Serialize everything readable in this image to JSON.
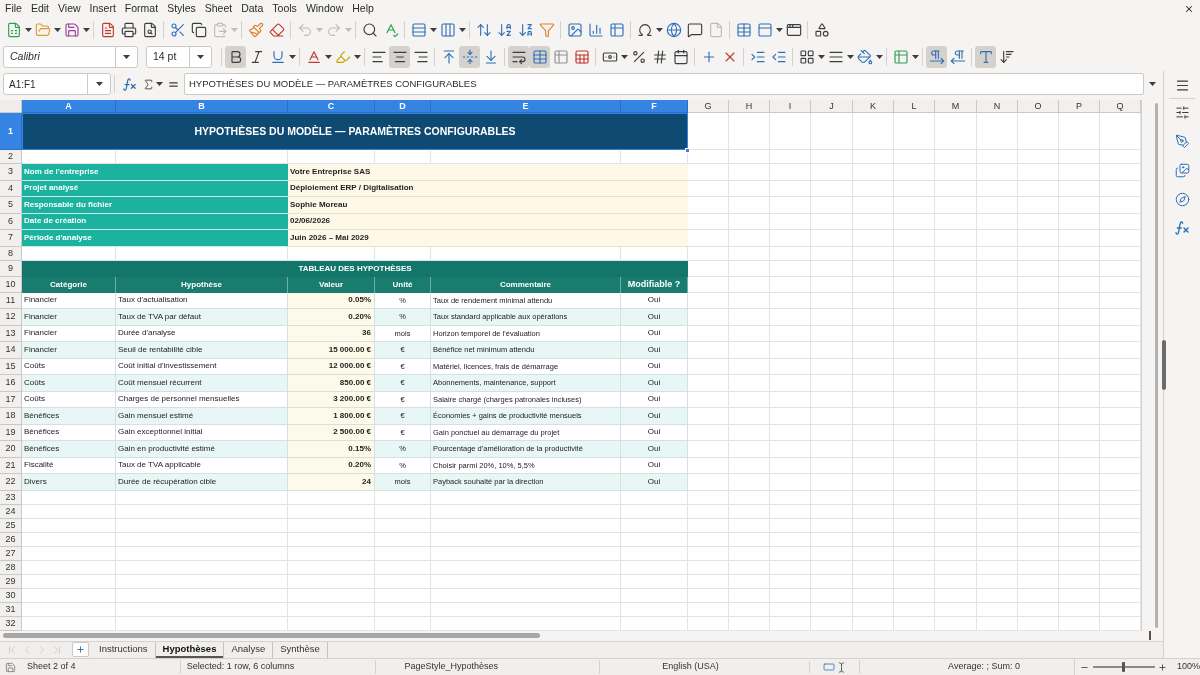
{
  "menu_bar": [
    "File",
    "Edit",
    "View",
    "Insert",
    "Format",
    "Styles",
    "Sheet",
    "Data",
    "Tools",
    "Window",
    "Help"
  ],
  "standard_toolbar": {
    "groups": [
      [
        {
          "kind": "new",
          "disabled": false
        },
        {
          "kind": "open",
          "disabled": false
        },
        {
          "kind": "save",
          "disabled": false
        }
      ],
      [
        {
          "kind": "export-pdf",
          "disabled": false
        },
        {
          "kind": "print",
          "disabled": false
        },
        {
          "kind": "print-preview",
          "disabled": false
        }
      ],
      [
        {
          "kind": "cut",
          "disabled": false
        },
        {
          "kind": "copy",
          "disabled": false
        },
        {
          "kind": "paste",
          "disabled": true
        }
      ],
      [
        {
          "kind": "clone-formatting",
          "disabled": false
        },
        {
          "kind": "clear-formatting",
          "disabled": false
        }
      ],
      [
        {
          "kind": "undo",
          "disabled": true
        },
        {
          "kind": "redo",
          "disabled": true
        }
      ],
      [
        {
          "kind": "find-replace",
          "disabled": false
        },
        {
          "kind": "spelling",
          "disabled": false
        }
      ],
      [
        {
          "kind": "rows",
          "disabled": false
        },
        {
          "kind": "columns",
          "disabled": false
        }
      ],
      [
        {
          "kind": "sort",
          "disabled": false
        },
        {
          "kind": "sort-ascending",
          "disabled": false
        },
        {
          "kind": "sort-descending",
          "disabled": false
        },
        {
          "kind": "autofilter",
          "disabled": false
        }
      ],
      [
        {
          "kind": "image",
          "disabled": false
        },
        {
          "kind": "chart",
          "disabled": false
        },
        {
          "kind": "pivot-table",
          "disabled": false
        }
      ],
      [
        {
          "kind": "special-character",
          "disabled": false
        },
        {
          "kind": "hyperlink",
          "disabled": false
        },
        {
          "kind": "comment",
          "disabled": false
        },
        {
          "kind": "header-footer",
          "disabled": true
        }
      ],
      [
        {
          "kind": "print-area",
          "disabled": false
        },
        {
          "kind": "freeze",
          "disabled": false
        },
        {
          "kind": "split-window",
          "disabled": false
        }
      ],
      [
        {
          "kind": "shapes",
          "disabled": false
        }
      ]
    ]
  },
  "formatting_toolbar": {
    "font_name": "Calibri",
    "font_size": "14 pt",
    "groups": [
      [
        {
          "kind": "bold",
          "pressed": true
        },
        {
          "kind": "italic",
          "pressed": false
        },
        {
          "kind": "underline",
          "pressed": false
        }
      ],
      [
        {
          "kind": "font-color",
          "pressed": false
        },
        {
          "kind": "highlight",
          "pressed": false
        }
      ],
      [
        {
          "kind": "align-left",
          "pressed": false
        },
        {
          "kind": "align-center",
          "pressed": true
        },
        {
          "kind": "align-right",
          "pressed": false
        }
      ],
      [
        {
          "kind": "align-top",
          "pressed": false
        },
        {
          "kind": "align-middle",
          "pressed": true
        },
        {
          "kind": "align-bottom",
          "pressed": false
        }
      ],
      [
        {
          "kind": "wrap-text",
          "pressed": true
        },
        {
          "kind": "merge-center",
          "pressed": true
        },
        {
          "kind": "merge",
          "pressed": false
        },
        {
          "kind": "unmerge",
          "pressed": false
        }
      ],
      [
        {
          "kind": "currency",
          "pressed": false
        },
        {
          "kind": "percent",
          "pressed": false
        },
        {
          "kind": "number",
          "pressed": false
        },
        {
          "kind": "date",
          "pressed": false
        }
      ],
      [
        {
          "kind": "add-decimal",
          "pressed": false
        },
        {
          "kind": "delete-decimal",
          "pressed": false
        }
      ],
      [
        {
          "kind": "indent-increase",
          "pressed": false
        },
        {
          "kind": "indent-decrease",
          "pressed": false
        }
      ],
      [
        {
          "kind": "borders",
          "pressed": false
        },
        {
          "kind": "border-style",
          "pressed": false
        },
        {
          "kind": "border-color",
          "pressed": false
        }
      ],
      [
        {
          "kind": "conditional",
          "pressed": false
        }
      ],
      [
        {
          "kind": "left-to-right",
          "pressed": true
        },
        {
          "kind": "right-to-left",
          "pressed": false
        }
      ],
      [
        {
          "kind": "text-horizontal",
          "pressed": true
        },
        {
          "kind": "text-vertical",
          "pressed": false
        }
      ]
    ]
  },
  "formula_bar": {
    "name_box": "A1:F1",
    "content": "HYPOTHÈSES DU MODÈLE — PARAMÈTRES CONFIGURABLES"
  },
  "sheet": {
    "column_headers": [
      {
        "label": "A",
        "selected": true
      },
      {
        "label": "B",
        "selected": true
      },
      {
        "label": "C",
        "selected": true
      },
      {
        "label": "D",
        "selected": true
      },
      {
        "label": "E",
        "selected": true
      },
      {
        "label": "F",
        "selected": true
      },
      {
        "label": "G",
        "selected": false
      },
      {
        "label": "H",
        "selected": false
      },
      {
        "label": "I",
        "selected": false
      },
      {
        "label": "J",
        "selected": false
      },
      {
        "label": "K",
        "selected": false
      },
      {
        "label": "L",
        "selected": false
      },
      {
        "label": "M",
        "selected": false
      },
      {
        "label": "N",
        "selected": false
      },
      {
        "label": "O",
        "selected": false
      },
      {
        "label": "P",
        "selected": false
      },
      {
        "label": "Q",
        "selected": false
      }
    ],
    "row_headers": [
      {
        "label": "1",
        "selected": true
      },
      {
        "label": "2",
        "selected": false
      },
      {
        "label": "3",
        "selected": false
      },
      {
        "label": "4",
        "selected": false
      },
      {
        "label": "5",
        "selected": false
      },
      {
        "label": "6",
        "selected": false
      },
      {
        "label": "7",
        "selected": false
      },
      {
        "label": "8",
        "selected": false
      },
      {
        "label": "9",
        "selected": false
      },
      {
        "label": "10",
        "selected": false
      },
      {
        "label": "11",
        "selected": false
      },
      {
        "label": "12",
        "selected": false
      },
      {
        "label": "13",
        "selected": false
      },
      {
        "label": "14",
        "selected": false
      },
      {
        "label": "15",
        "selected": false
      },
      {
        "label": "16",
        "selected": false
      },
      {
        "label": "17",
        "selected": false
      },
      {
        "label": "18",
        "selected": false
      },
      {
        "label": "19",
        "selected": false
      },
      {
        "label": "20",
        "selected": false
      },
      {
        "label": "21",
        "selected": false
      },
      {
        "label": "22",
        "selected": false
      },
      {
        "label": "23",
        "selected": false
      },
      {
        "label": "24",
        "selected": false
      },
      {
        "label": "25",
        "selected": false
      },
      {
        "label": "26",
        "selected": false
      },
      {
        "label": "27",
        "selected": false
      },
      {
        "label": "28",
        "selected": false
      },
      {
        "label": "29",
        "selected": false
      },
      {
        "label": "30",
        "selected": false
      },
      {
        "label": "31",
        "selected": false
      },
      {
        "label": "32",
        "selected": false
      }
    ],
    "title": "HYPOTHÈSES DU MODÈLE — PARAMÈTRES CONFIGURABLES",
    "info": [
      {
        "label": "Nom de l'entreprise",
        "value": "Votre Entreprise SAS"
      },
      {
        "label": "Projet analysé",
        "value": "Déploiement ERP / Digitalisation"
      },
      {
        "label": "Responsable du fichier",
        "value": "Sophie Moreau"
      },
      {
        "label": "Date de création",
        "value": "02/06/2026"
      },
      {
        "label": "Période d'analyse",
        "value": "Juin 2026 – Mai 2029"
      }
    ],
    "table": {
      "title": "TABLEAU DES HYPOTHÈSES",
      "columns": [
        "Catégorie",
        "Hypothèse",
        "Valeur",
        "Unité",
        "Commentaire",
        "Modifiable ?"
      ],
      "rows": [
        {
          "category": "Financier",
          "hypothesis": "Taux d'actualisation",
          "value": "0.05%",
          "unit": "%",
          "comment": "Taux de rendement minimal attendu",
          "modifiable": "Oui"
        },
        {
          "category": "Financier",
          "hypothesis": "Taux de TVA par défaut",
          "value": "0.20%",
          "unit": "%",
          "comment": "Taux standard applicable aux opérations",
          "modifiable": "Oui"
        },
        {
          "category": "Financier",
          "hypothesis": "Durée d'analyse",
          "value": "36",
          "unit": "mois",
          "comment": "Horizon temporel de l'évaluation",
          "modifiable": "Oui"
        },
        {
          "category": "Financier",
          "hypothesis": "Seuil de rentabilité cible",
          "value": "15 000.00 €",
          "unit": "€",
          "comment": "Bénéfice net minimum attendu",
          "modifiable": "Oui"
        },
        {
          "category": "Coûts",
          "hypothesis": "Coût initial d'investissement",
          "value": "12 000.00 €",
          "unit": "€",
          "comment": "Matériel, licences, frais de démarrage",
          "modifiable": "Oui"
        },
        {
          "category": "Coûts",
          "hypothesis": "Coût mensuel récurrent",
          "value": "850.00 €",
          "unit": "€",
          "comment": "Abonnements, maintenance, support",
          "modifiable": "Oui"
        },
        {
          "category": "Coûts",
          "hypothesis": "Charges de personnel mensuelles",
          "value": "3 200.00 €",
          "unit": "€",
          "comment": "Salaire chargé (charges patronales incluses)",
          "modifiable": "Oui"
        },
        {
          "category": "Bénéfices",
          "hypothesis": "Gain mensuel estimé",
          "value": "1 800.00 €",
          "unit": "€",
          "comment": "Économies + gains de productivité mensuels",
          "modifiable": "Oui"
        },
        {
          "category": "Bénéfices",
          "hypothesis": "Gain exceptionnel initial",
          "value": "2 500.00 €",
          "unit": "€",
          "comment": "Gain ponctuel au démarrage du projet",
          "modifiable": "Oui"
        },
        {
          "category": "Bénéfices",
          "hypothesis": "Gain en productivité estimé",
          "value": "0.15%",
          "unit": "%",
          "comment": "Pourcentage d'amélioration de la productivité",
          "modifiable": "Oui"
        },
        {
          "category": "Fiscalité",
          "hypothesis": "Taux de TVA applicable",
          "value": "0.20%",
          "unit": "%",
          "comment": "Choisir parmi 20%, 10%, 5,5%",
          "modifiable": "Oui"
        },
        {
          "category": "Divers",
          "hypothesis": "Durée de récupération cible",
          "value": "24",
          "unit": "mois",
          "comment": "Payback souhaité par la direction",
          "modifiable": "Oui"
        }
      ]
    }
  },
  "sheet_tabs": {
    "navigation": [
      {
        "kind": "first",
        "disabled": true
      },
      {
        "kind": "previous",
        "disabled": true
      },
      {
        "kind": "next",
        "disabled": true
      },
      {
        "kind": "last",
        "disabled": true
      }
    ],
    "tabs": [
      {
        "label": "Instructions",
        "selected": false
      },
      {
        "label": "Hypothèses",
        "selected": true
      },
      {
        "label": "Analyse",
        "selected": false
      },
      {
        "label": "Synthèse",
        "selected": false
      }
    ]
  },
  "status_bar": {
    "sheet": "Sheet 2 of 4",
    "selection": "Selected: 1 row, 6 columns",
    "page_style": "PageStyle_Hypothèses",
    "language": "English (USA)",
    "summary": "Average: ; Sum: 0",
    "zoom": {
      "level": 0.5,
      "reading": "100%"
    }
  }
}
